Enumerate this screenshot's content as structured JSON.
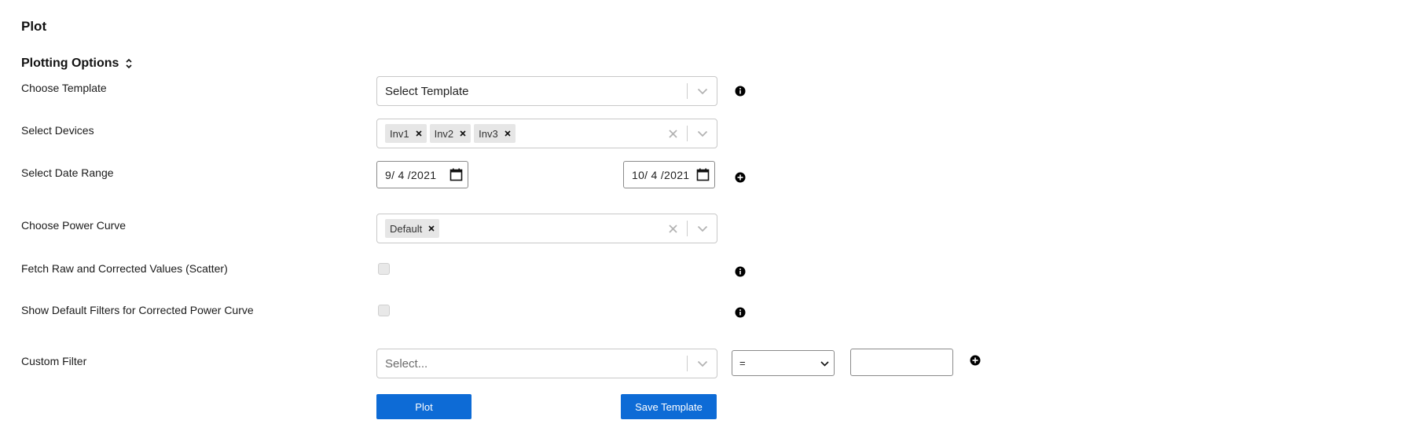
{
  "page": {
    "title": "Plot"
  },
  "section": {
    "title": "Plotting Options",
    "collapse_icon": "collapse-chevrons-icon"
  },
  "rows": {
    "template": {
      "label": "Choose Template",
      "placeholder": "Select Template"
    },
    "devices": {
      "label": "Select Devices",
      "tags": [
        "Inv1",
        "Inv2",
        "Inv3"
      ]
    },
    "date_range": {
      "label": "Select Date Range",
      "start": "9/ 4 /2021",
      "end": "10/ 4 /2021"
    },
    "power_curve": {
      "label": "Choose Power Curve",
      "tags": [
        "Default"
      ]
    },
    "fetch_raw": {
      "label": "Fetch Raw and Corrected Values (Scatter)",
      "checked": false
    },
    "default_filters": {
      "label": "Show Default Filters for Corrected Power Curve",
      "checked": false
    },
    "custom_filter": {
      "label": "Custom Filter",
      "placeholder": "Select...",
      "operator": "=",
      "value": ""
    }
  },
  "buttons": {
    "plot": "Plot",
    "save_template": "Save Template"
  },
  "icons": {
    "remove": "×"
  },
  "colors": {
    "primary": "#0d6bd6"
  }
}
